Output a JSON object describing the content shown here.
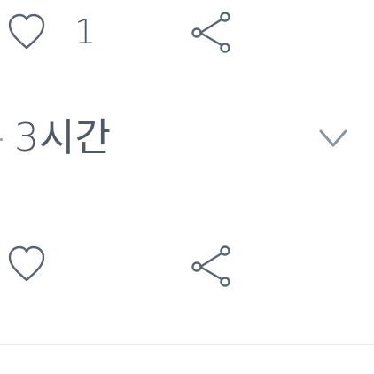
{
  "post_actions": {
    "like_count": "1",
    "timestamp": "3시간"
  },
  "icons": {
    "like": "heart-outline-icon",
    "share": "share-icon",
    "expand": "chevron-down-icon"
  },
  "colors": {
    "icon_stroke": "#5b6571",
    "chevron": "#8b95a1",
    "divider": "#e6e9ec",
    "text": "#505a66"
  }
}
